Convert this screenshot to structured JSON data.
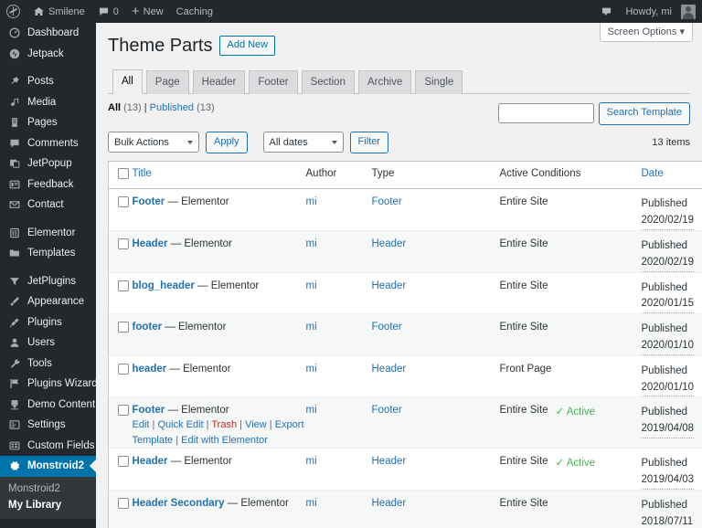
{
  "adminbar": {
    "site_name": "Smilene",
    "comment_count": "0",
    "new_label": "New",
    "caching_label": "Caching",
    "howdy": "Howdy, mi"
  },
  "sidebar": {
    "items": [
      {
        "label": "Dashboard",
        "icon": "dashboard-icon",
        "sep": false
      },
      {
        "label": "Jetpack",
        "icon": "jetpack-icon",
        "sep": false
      },
      {
        "label": "Posts",
        "icon": "pin-icon",
        "sep": true
      },
      {
        "label": "Media",
        "icon": "media-icon",
        "sep": false
      },
      {
        "label": "Pages",
        "icon": "page-icon",
        "sep": false
      },
      {
        "label": "Comments",
        "icon": "comment-icon",
        "sep": false
      },
      {
        "label": "JetPopup",
        "icon": "popup-icon",
        "sep": false
      },
      {
        "label": "Feedback",
        "icon": "feedback-icon",
        "sep": false
      },
      {
        "label": "Contact",
        "icon": "envelope-icon",
        "sep": false
      },
      {
        "label": "Elementor",
        "icon": "elementor-icon",
        "sep": true
      },
      {
        "label": "Templates",
        "icon": "folder-icon",
        "sep": false
      },
      {
        "label": "JetPlugins",
        "icon": "funnel-icon",
        "sep": true
      },
      {
        "label": "Appearance",
        "icon": "brush-icon",
        "sep": false
      },
      {
        "label": "Plugins",
        "icon": "plug-icon",
        "sep": false
      },
      {
        "label": "Users",
        "icon": "user-icon",
        "sep": false
      },
      {
        "label": "Tools",
        "icon": "wrench-icon",
        "sep": false
      },
      {
        "label": "Plugins Wizard",
        "icon": "flag-icon",
        "sep": false
      },
      {
        "label": "Demo Content",
        "icon": "download-icon",
        "sep": false
      },
      {
        "label": "Settings",
        "icon": "sliders-icon",
        "sep": false
      },
      {
        "label": "Custom Fields",
        "icon": "grid-icon",
        "sep": false
      }
    ],
    "current": {
      "label": "Monstroid2",
      "icon": "gear-icon"
    },
    "submenu": [
      {
        "label": "Monstroid2",
        "current": false
      },
      {
        "label": "My Library",
        "current": true
      }
    ]
  },
  "screen_options": {
    "label": "Screen Options"
  },
  "header": {
    "title": "Theme Parts",
    "add_new": "Add New"
  },
  "tabs": [
    {
      "label": "All",
      "active": true
    },
    {
      "label": "Page",
      "active": false
    },
    {
      "label": "Header",
      "active": false
    },
    {
      "label": "Footer",
      "active": false
    },
    {
      "label": "Section",
      "active": false
    },
    {
      "label": "Archive",
      "active": false
    },
    {
      "label": "Single",
      "active": false
    }
  ],
  "filters": {
    "status_all": "All",
    "status_all_count": "(13)",
    "status_published": "Published",
    "status_published_count": "(13)",
    "separator": "|",
    "bulk_actions": "Bulk Actions",
    "apply": "Apply",
    "all_dates": "All dates",
    "filter": "Filter",
    "items_count": "13 items"
  },
  "search": {
    "value": "",
    "placeholder": "",
    "button": "Search Template"
  },
  "table": {
    "columns": {
      "title": "Title",
      "author": "Author",
      "type": "Type",
      "conditions": "Active Conditions",
      "date": "Date"
    },
    "rows": [
      {
        "title": "Footer",
        "suffix": " — Elementor",
        "author": "mi",
        "type": "Footer",
        "condition": "Entire Site",
        "active": "",
        "status": "Published",
        "date": "2020/02/19",
        "alt": false
      },
      {
        "title": "Header",
        "suffix": " — Elementor",
        "author": "mi",
        "type": "Header",
        "condition": "Entire Site",
        "active": "",
        "status": "Published",
        "date": "2020/02/19",
        "alt": true
      },
      {
        "title": "blog_header",
        "suffix": " — Elementor",
        "author": "mi",
        "type": "Header",
        "condition": "Entire Site",
        "active": "",
        "status": "Published",
        "date": "2020/01/15",
        "alt": false
      },
      {
        "title": "footer",
        "suffix": " — Elementor",
        "author": "mi",
        "type": "Footer",
        "condition": "Entire Site",
        "active": "",
        "status": "Published",
        "date": "2020/01/10",
        "alt": true
      },
      {
        "title": "header",
        "suffix": " — Elementor",
        "author": "mi",
        "type": "Header",
        "condition": "Front Page",
        "active": "",
        "status": "Published",
        "date": "2020/01/10",
        "alt": false
      },
      {
        "title": "Footer",
        "suffix": " — Elementor",
        "author": "mi",
        "type": "Footer",
        "condition": "Entire Site",
        "active": "Active",
        "status": "Published",
        "date": "2019/04/08",
        "alt": true,
        "hovered": true
      },
      {
        "title": "Header",
        "suffix": " — Elementor",
        "author": "mi",
        "type": "Header",
        "condition": "Entire Site",
        "active": "Active",
        "status": "Published",
        "date": "2019/04/03",
        "alt": false
      },
      {
        "title": "Header Secondary",
        "suffix": " — Elementor",
        "author": "mi",
        "type": "Header",
        "condition": "Entire Site",
        "active": "",
        "status": "Published",
        "date": "2018/07/11",
        "alt": true
      }
    ],
    "row_actions": {
      "edit": "Edit",
      "quick_edit": "Quick Edit",
      "trash": "Trash",
      "view": "View",
      "export": "Export Template",
      "elementor": "Edit with Elementor",
      "sep": "|"
    }
  },
  "colors": {
    "admin_bar": "#23282d",
    "sidebar": "#23282d",
    "accent": "#0073aa",
    "link": "#2271b1",
    "active_green": "#46b450",
    "trash_red": "#b32d2e"
  }
}
